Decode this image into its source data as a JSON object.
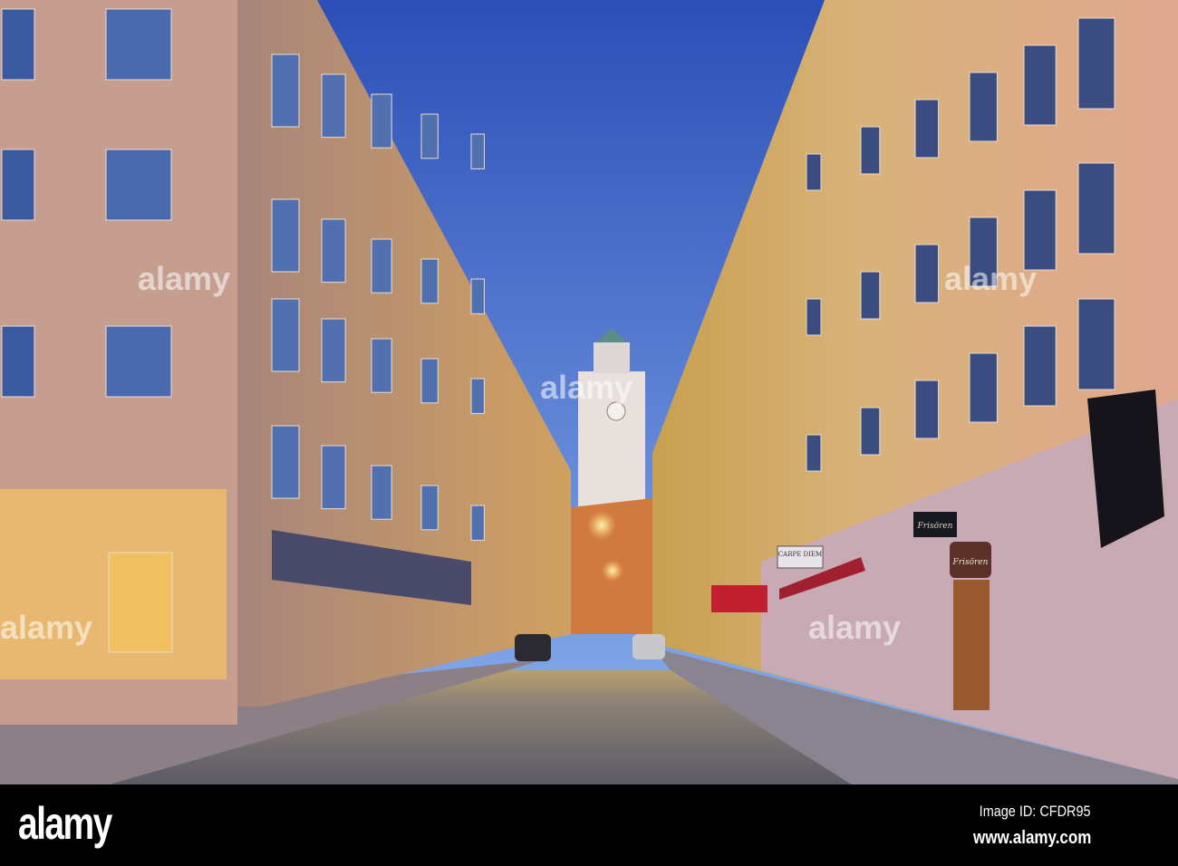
{
  "photo": {
    "signs": {
      "carpe_diem": "CARPE DIEM",
      "hair_salon_hanging": "Frisören",
      "hair_salon_door": "Frisören"
    },
    "watermark_text": "alamy"
  },
  "footer": {
    "logo": "alamy",
    "image_id": "Image ID: CFDR95",
    "website": "www.alamy.com"
  },
  "colors": {
    "sky_top": "#2c4fb8",
    "sky_bottom": "#7ea6e8",
    "facade": "#c9a090",
    "street": "#6e6a70",
    "lamp": "#ffd36a"
  }
}
